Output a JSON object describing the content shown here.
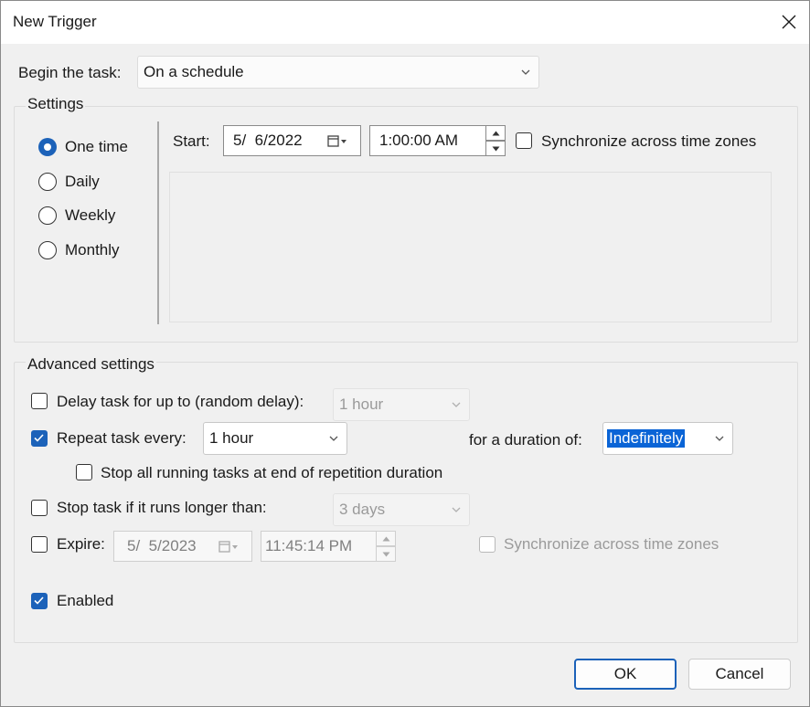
{
  "window": {
    "title": "New Trigger"
  },
  "begin": {
    "label": "Begin the task:",
    "value": "On a schedule"
  },
  "settings": {
    "title": "Settings",
    "options": [
      {
        "label": "One time",
        "selected": true
      },
      {
        "label": "Daily",
        "selected": false
      },
      {
        "label": "Weekly",
        "selected": false
      },
      {
        "label": "Monthly",
        "selected": false
      }
    ],
    "start_label": "Start:",
    "start_date": "5/  6/2022",
    "start_time": "1:00:00 AM",
    "sync_label": "Synchronize across time zones",
    "sync_checked": false
  },
  "advanced": {
    "title": "Advanced settings",
    "delay": {
      "label": "Delay task for up to (random delay):",
      "checked": false,
      "value": "1 hour"
    },
    "repeat": {
      "label": "Repeat task every:",
      "checked": true,
      "value": "1 hour",
      "duration_label": "for a duration of:",
      "duration_value": "Indefinitely"
    },
    "stop_all": {
      "label": "Stop all running tasks at end of repetition duration",
      "checked": false
    },
    "stop_long": {
      "label": "Stop task if it runs longer than:",
      "checked": false,
      "value": "3 days"
    },
    "expire": {
      "label": "Expire:",
      "checked": false,
      "date": "5/  5/2023",
      "time": "11:45:14 PM",
      "sync_label": "Synchronize across time zones"
    },
    "enabled": {
      "label": "Enabled",
      "checked": true
    }
  },
  "buttons": {
    "ok": "OK",
    "cancel": "Cancel"
  },
  "colors": {
    "accent": "#1c62b9",
    "selection": "#0a64d6"
  }
}
